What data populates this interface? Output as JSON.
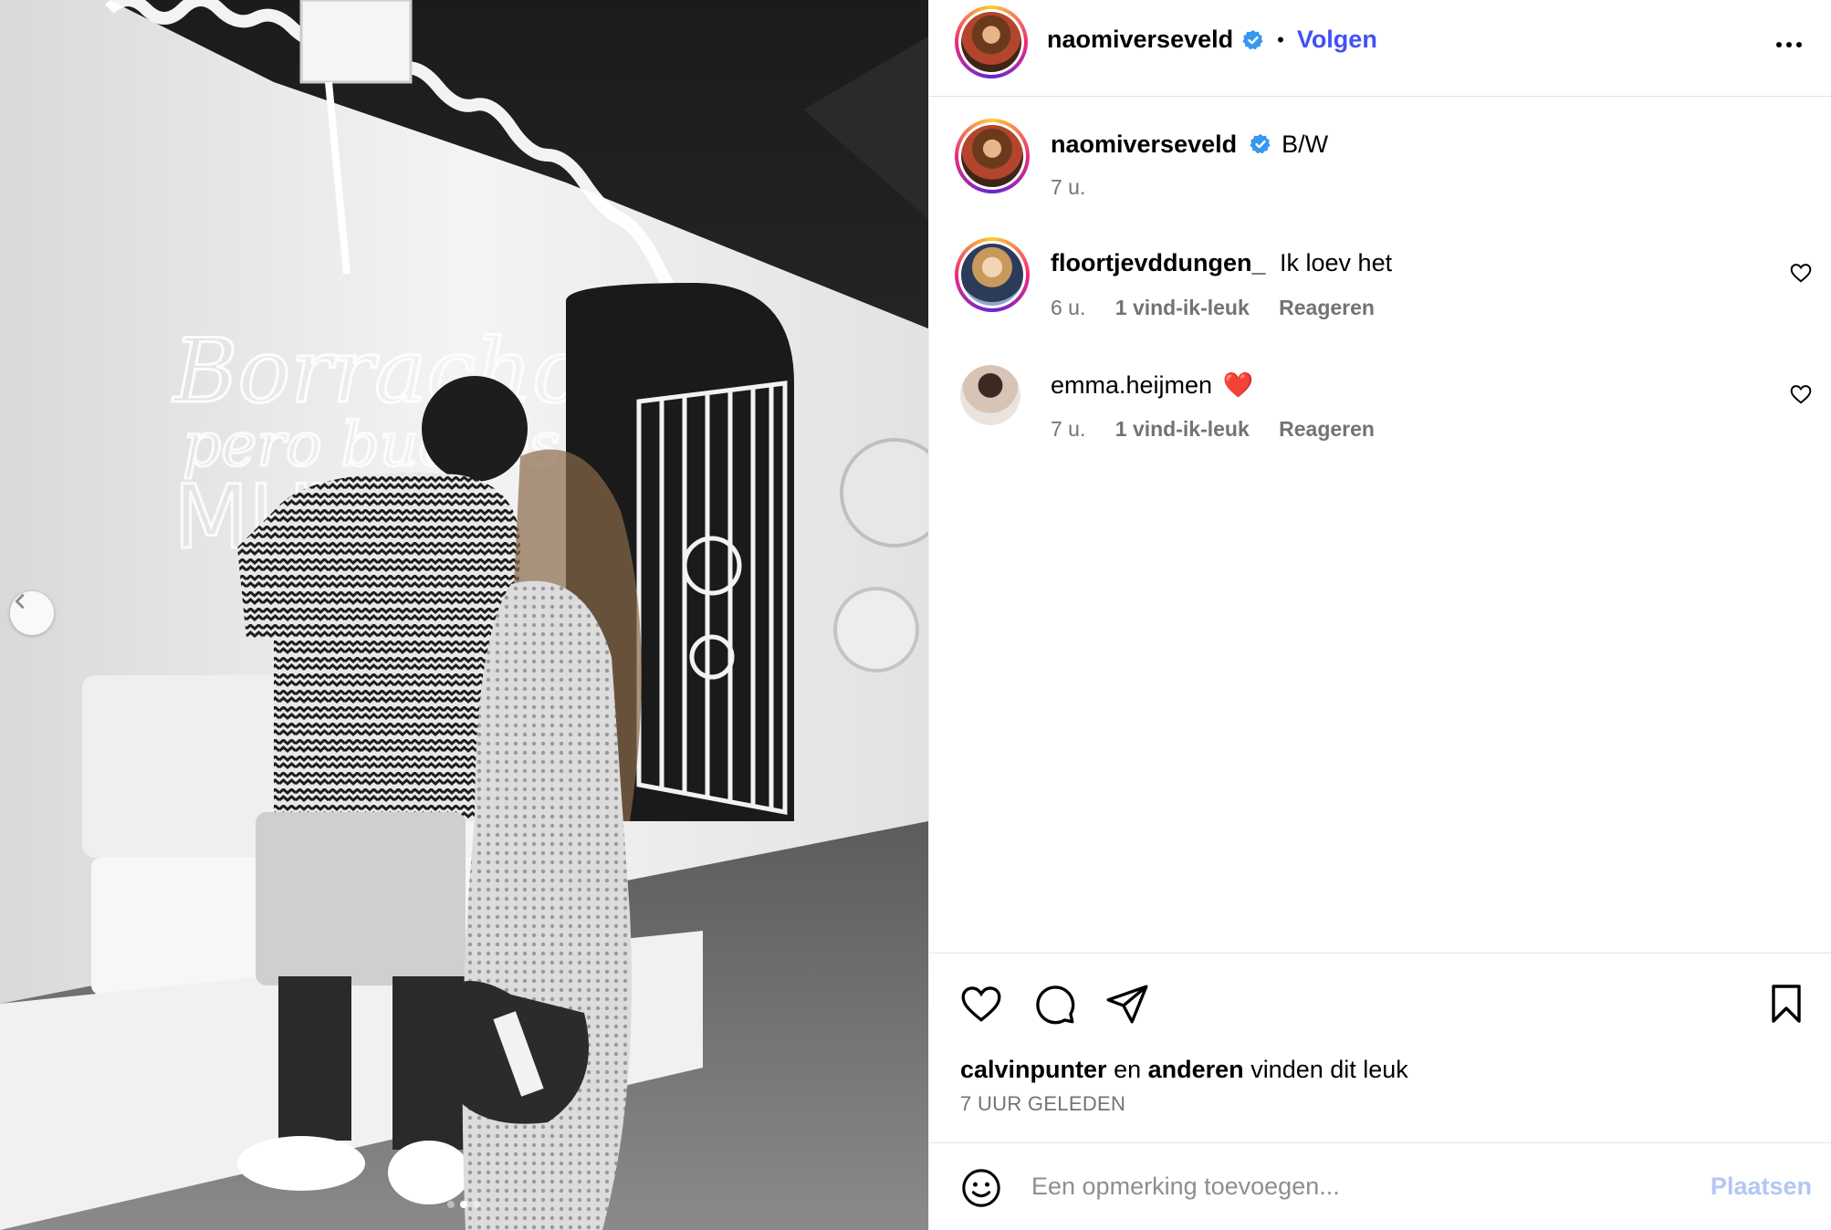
{
  "post": {
    "author": "naomiverseveld",
    "follow_label": "Volgen",
    "separator": "•",
    "verified_icon": "verified-badge-icon",
    "more_icon": "more-options-icon"
  },
  "caption": {
    "username": "naomiverseveld",
    "text": "B/W",
    "time": "7 u."
  },
  "comments": [
    {
      "username": "floortjevddungen_",
      "text": "Ik loev het",
      "time": "6 u.",
      "likes": "1 vind-ik-leuk",
      "reply": "Reageren"
    },
    {
      "username": "emma.heijmen",
      "text": "❤️",
      "time": "7 u.",
      "likes": "1 vind-ik-leuk",
      "reply": "Reageren"
    }
  ],
  "likes": {
    "user": "calvinpunter",
    "connector": "en",
    "others": "anderen",
    "suffix": "vinden dit leuk"
  },
  "timestamp": "7 UUR GELEDEN",
  "comment_box": {
    "placeholder": "Een opmerking toevoegen...",
    "post_label": "Plaatsen"
  },
  "colors": {
    "follow": "#4150f7",
    "verified": "#3897f0",
    "muted": "#737373",
    "post_disabled": "#b3c6f5"
  },
  "carousel": {
    "prev_icon": "chevron-left-icon",
    "current_index": 2,
    "total": 3
  }
}
